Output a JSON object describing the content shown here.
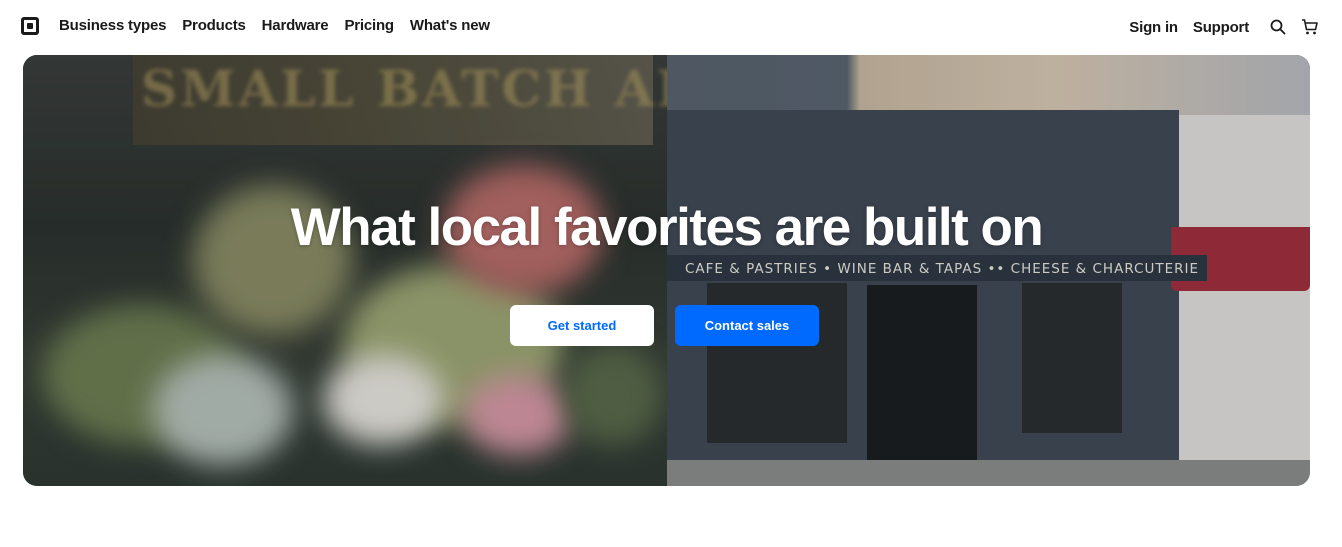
{
  "nav": {
    "links": [
      "Business types",
      "Products",
      "Hardware",
      "Pricing",
      "What's new"
    ],
    "sign_in": "Sign in",
    "support": "Support",
    "icons": {
      "logo": "square-logo-icon",
      "search": "search-icon",
      "cart": "cart-icon"
    }
  },
  "hero": {
    "title": "What local favorites are built on",
    "primary_button": "Get started",
    "secondary_button": "Contact sales",
    "background_sign_text": "SMALL BATCH ART",
    "storefront_awning_text": "CAFE & PASTRIES  •  WINE BAR & TAPAS  ••  CHEESE & CHARCUTERIE"
  },
  "colors": {
    "accent": "#006aff",
    "text": "#1a1a1a",
    "background": "#ffffff"
  }
}
